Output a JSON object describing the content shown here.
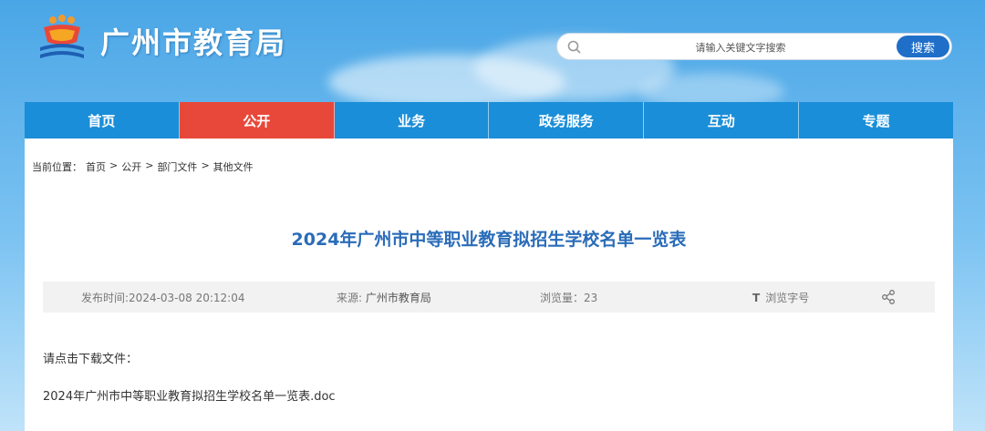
{
  "header": {
    "site_title": "广州市教育局",
    "logo_icon": "guangzhou-education-emblem",
    "search": {
      "placeholder": "请输入关键文字搜索",
      "button_label": "搜索"
    }
  },
  "nav": {
    "items": [
      {
        "label": "首页",
        "active": false
      },
      {
        "label": "公开",
        "active": true
      },
      {
        "label": "业务",
        "active": false
      },
      {
        "label": "政务服务",
        "active": false
      },
      {
        "label": "互动",
        "active": false
      },
      {
        "label": "专题",
        "active": false
      }
    ],
    "colors": {
      "bar": "#1a8ed8",
      "active": "#e8483a"
    }
  },
  "breadcrumb": {
    "prefix": "当前位置：",
    "items": [
      "首页",
      "公开",
      "部门文件",
      "其他文件"
    ],
    "separator": ">"
  },
  "article": {
    "title": "2024年广州市中等职业教育拟招生学校名单一览表",
    "meta": {
      "time": "发布时间:2024-03-08 20:12:04",
      "source_label": "来源:",
      "source_value": "广州市教育局",
      "views": "浏览量：23",
      "font_icon": "T",
      "font_label": "浏览字号",
      "share_icon": "share-icon"
    },
    "body": {
      "intro": "请点击下载文件：",
      "file": "2024年广州市中等职业教育拟招生学校名单一览表.doc"
    }
  }
}
